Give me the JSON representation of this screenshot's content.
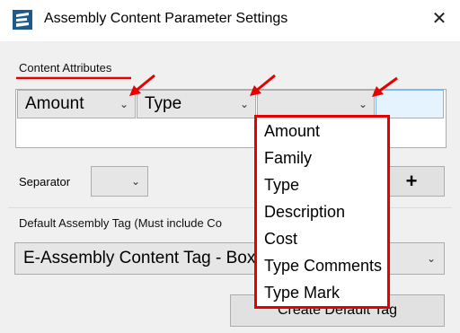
{
  "window": {
    "title": "Assembly Content Parameter Settings",
    "close_label": "✕"
  },
  "content_attributes": {
    "group_label": "Content Attributes",
    "combos": [
      {
        "value": "Amount"
      },
      {
        "value": "Type"
      },
      {
        "value": ""
      }
    ]
  },
  "separator": {
    "label": "Separator",
    "value": ""
  },
  "add_button": {
    "label": "+"
  },
  "default_tag": {
    "group_label": "Default Assembly Tag (Must include Co",
    "selected": "E-Assembly Content Tag - Boxed",
    "create_button_label": "Create Default Tag"
  },
  "dropdown": {
    "options": [
      "Amount",
      "Family",
      "Type",
      "Description",
      "Cost",
      "Type Comments",
      "Type Mark"
    ]
  },
  "colors": {
    "annotation_red": "#e60000",
    "selected_cell": "#e5f3ff",
    "dialog_bg": "#f0f0f0"
  },
  "icons": {
    "app": "app-logo-icon",
    "close": "close-icon",
    "chevron": "chevron-down-icon",
    "annotation": "red-arrow-icon"
  }
}
